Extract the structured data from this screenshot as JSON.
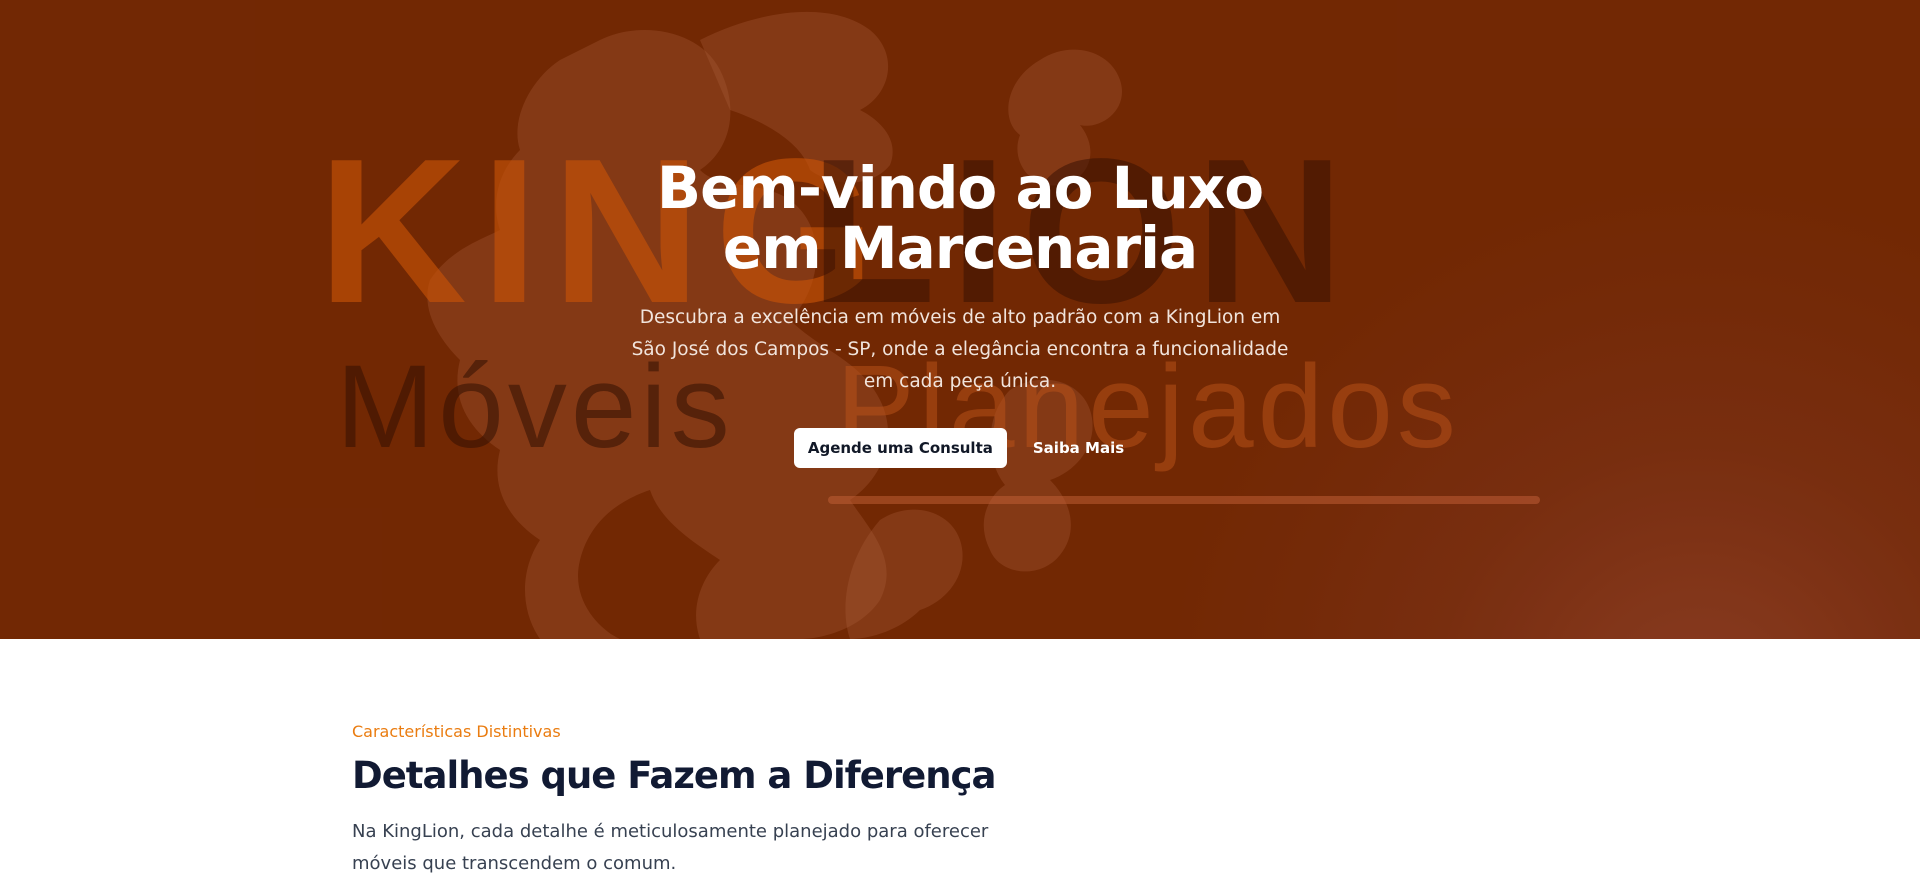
{
  "colors": {
    "hero_background": "#722804",
    "accent": "#ea7c10",
    "heading_dark": "#111a33",
    "button_background": "#ffffff"
  },
  "hero": {
    "background_logo": {
      "word_king": "KING",
      "word_lion": "LION",
      "word_moveis": "Móveis",
      "word_planejados": "Planejados",
      "emblem": "lion-emblem"
    },
    "title": "Bem-vindo ao Luxo em Marcenaria",
    "subtitle": "Descubra a excelência em móveis de alto padrão com a KingLion em São José dos Campos - SP, onde a elegância encontra a funcionalidade em cada peça única.",
    "primary_button": "Agende uma Consulta",
    "secondary_button": "Saiba Mais"
  },
  "features": {
    "eyebrow": "Características Distintivas",
    "title": "Detalhes que Fazem a Diferença",
    "text": "Na KingLion, cada detalhe é meticulosamente planejado para oferecer móveis que transcendem o comum."
  }
}
